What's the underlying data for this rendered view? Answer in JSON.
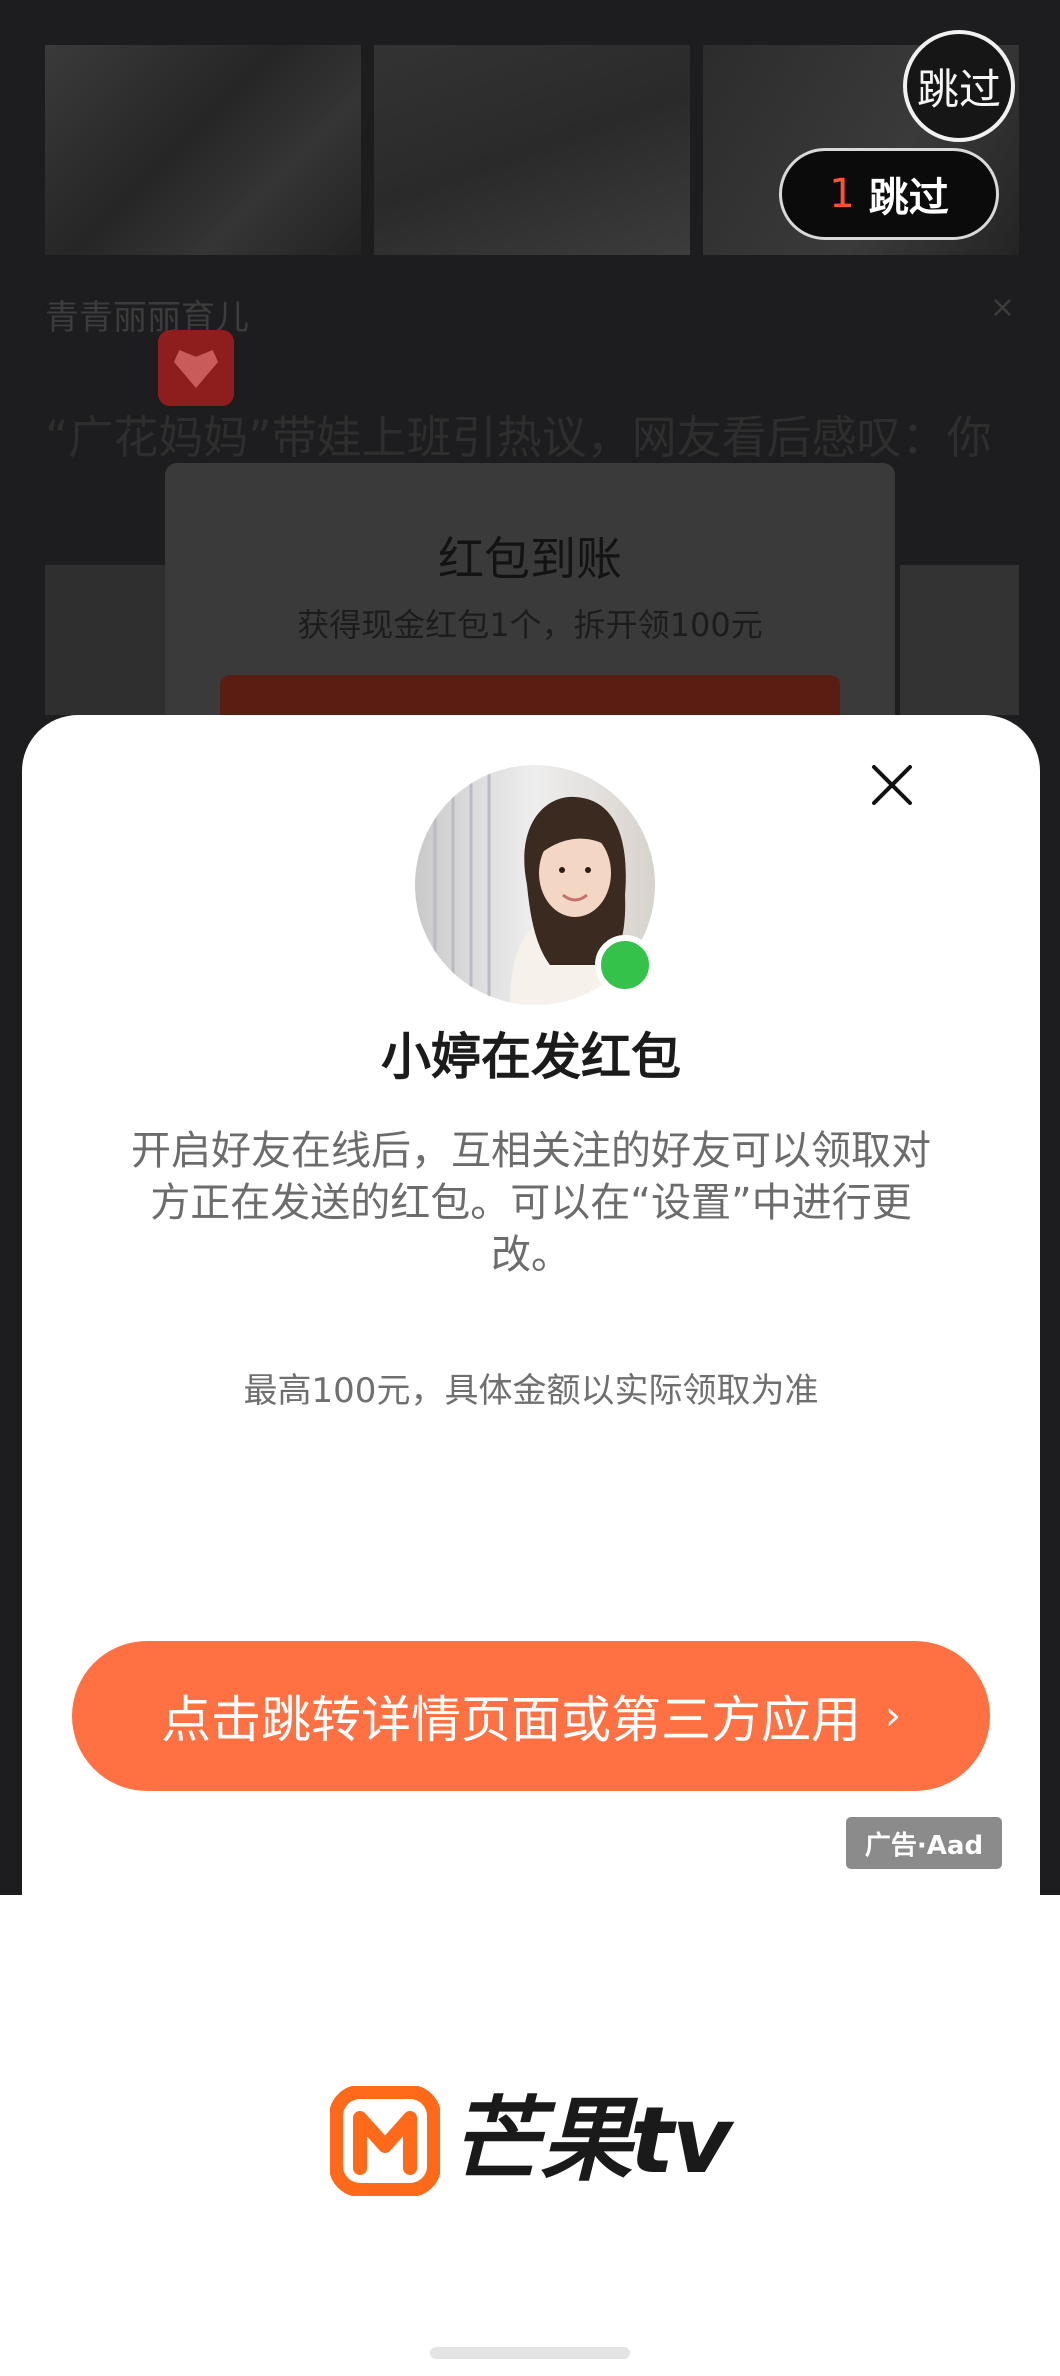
{
  "background_feed": {
    "source_name": "青青丽丽育儿",
    "headline": "“广花妈妈”带娃上班引热议，网友看后感叹：你",
    "close_glyph": "×",
    "popup": {
      "title": "红包到账",
      "subtitle": "获得现金红包1个，拆开领100元"
    }
  },
  "skip": {
    "circle_label": "跳过",
    "countdown": "1",
    "pill_label": "跳过"
  },
  "ad_sheet": {
    "title": "小婷在发红包",
    "description": "开启好友在线后，互相关注的好友可以领取对方正在发送的红包。可以在“设置”中进行更改。",
    "note": "最高100元，具体金额以实际领取为准",
    "cta_label": "点击跳转详情页面或第三方应用",
    "cta_arrow": "›",
    "ad_badge": "广告·Aad",
    "online_status": "online"
  },
  "footer": {
    "brand_name": "芒果tv"
  },
  "colors": {
    "cta": "#ff7043",
    "online": "#34c24b",
    "countdown": "#ff5133",
    "brand_orange": "#ff6a1a"
  },
  "icons": {
    "close": "close-icon",
    "avatar": "avatar",
    "brand": "mango-tv-logo-icon"
  }
}
